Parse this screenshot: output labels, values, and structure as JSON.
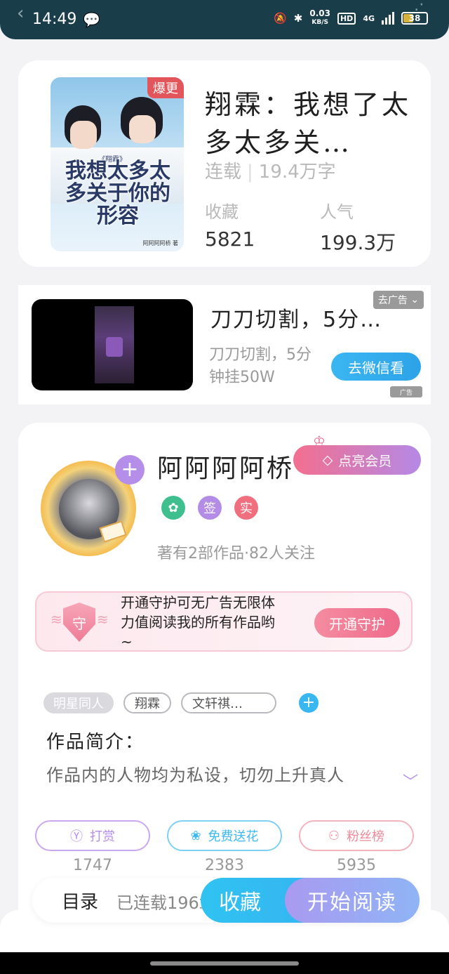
{
  "status_bar": {
    "time": "14:49",
    "net_speed": "0.03",
    "net_unit": "KB/S",
    "hd": "HD",
    "network": "4G",
    "battery": "38"
  },
  "book": {
    "badge": "爆更",
    "cover_title": "我想太多太多关于你的形容",
    "cover_small": "《翔霖》",
    "cover_author": "阿阿阿阿桥 著",
    "title": "翔霖：我想了太多太多关…",
    "status": "连载",
    "word_count": "19.4万字",
    "favorites_label": "收藏",
    "favorites_value": "5821",
    "popularity_label": "人气",
    "popularity_value": "199.3万"
  },
  "ad": {
    "title": "刀刀切割，5分…",
    "subtitle": "刀刀切割，5分钟挂50W",
    "close_label": "去广告",
    "button_label": "去微信看",
    "tag_label": "广告"
  },
  "author": {
    "name": "阿阿阿阿桥",
    "vip_label": "点亮会员",
    "badge_sign": "签",
    "badge_real": "实",
    "meta": "著有2部作品·82人关注",
    "guard_icon_text": "守",
    "guard_text": "开通守护可无广告无限体力值阅读我的所有作品哟~",
    "guard_button": "开通守护",
    "tags": [
      "明星同人",
      "翔霖",
      "文轩祺…"
    ],
    "intro_title": "作品简介：",
    "intro_text": "作品内的人物均为私设，切勿上升真人",
    "actions": [
      {
        "label": "打赏",
        "count": "1747",
        "color": "#b68de8"
      },
      {
        "label": "免费送花",
        "count": "2383",
        "color": "#3db8f0"
      },
      {
        "label": "粉丝榜",
        "count": "5935",
        "color": "#ee8a9a"
      }
    ]
  },
  "bottom": {
    "toc_label": "目录",
    "chapters": "已连载196章",
    "favorite_label": "收藏",
    "read_label": "开始阅读"
  }
}
